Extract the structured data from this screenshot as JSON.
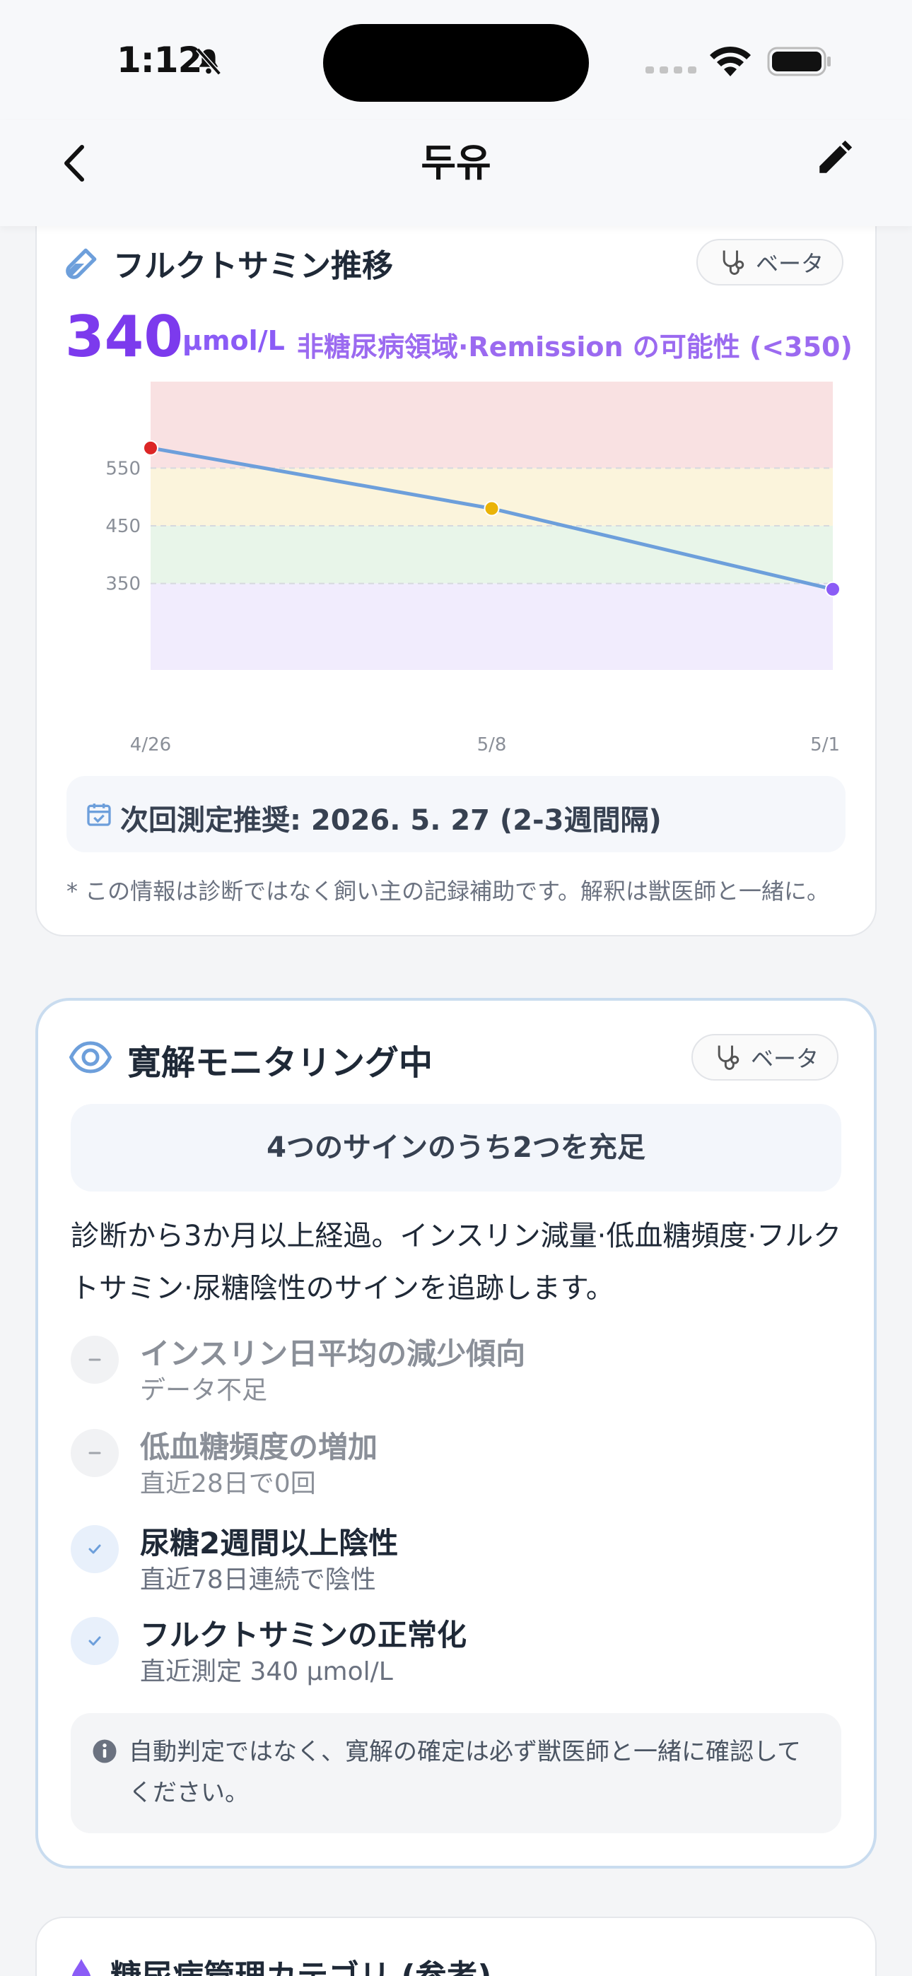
{
  "status_bar": {
    "time": "1:12"
  },
  "nav": {
    "title": "두유"
  },
  "fructosamine_card": {
    "title": "フルクトサミン推移",
    "badge": "ベータ",
    "value": "340",
    "unit": "μmol/L",
    "status": "非糖尿病領域·Remission の可能性 (<350)",
    "next_measure": "次回測定推奨: 2026. 5. 27 (2-3週間隔)",
    "disclaimer": "* この情報は診断ではなく飼い主の記録補助です。解釈は獣医師と一緒に。"
  },
  "chart_data": {
    "type": "line",
    "x": [
      "4/26",
      "5/8",
      "5/1"
    ],
    "y": [
      585,
      480,
      340
    ],
    "point_colors": [
      "#dc2626",
      "#eab308",
      "#8b5cf6"
    ],
    "y_ticks": [
      "550",
      "450",
      "350"
    ],
    "y_tick_values": [
      550,
      450,
      350
    ],
    "ylim": [
      200,
      700
    ],
    "bands": [
      {
        "from": 550,
        "to": 700,
        "color": "#f9e1e2"
      },
      {
        "from": 450,
        "to": 550,
        "color": "#fbf4dc"
      },
      {
        "from": 350,
        "to": 450,
        "color": "#e8f5e9"
      },
      {
        "from": 200,
        "to": 350,
        "color": "#f1ecfd"
      }
    ],
    "line_color": "#6d9fdb"
  },
  "remission_card": {
    "title": "寛解モニタリング中",
    "badge": "ベータ",
    "summary": "4つのサインのうち2つを充足",
    "description": "診断から3か月以上経過。インスリン減量·低血糖頻度·フルクトサミン·尿糖陰性のサインを追跡します。",
    "signs": [
      {
        "name": "インスリン日平均の減少傾向",
        "detail": "データ不足",
        "met": false
      },
      {
        "name": "低血糖頻度の増加",
        "detail": "直近28日で0回",
        "met": false
      },
      {
        "name": "尿糖2週間以上陰性",
        "detail": "直近78日連続で陰性",
        "met": true
      },
      {
        "name": "フルクトサミンの正常化",
        "detail": "直近測定 340 μmol/L",
        "met": true
      }
    ],
    "note": "自動判定ではなく、寛解の確定は必ず獣医師と一緒に確認してください。"
  },
  "category_card": {
    "title": "糖尿病管理カテゴリ (参考)"
  }
}
